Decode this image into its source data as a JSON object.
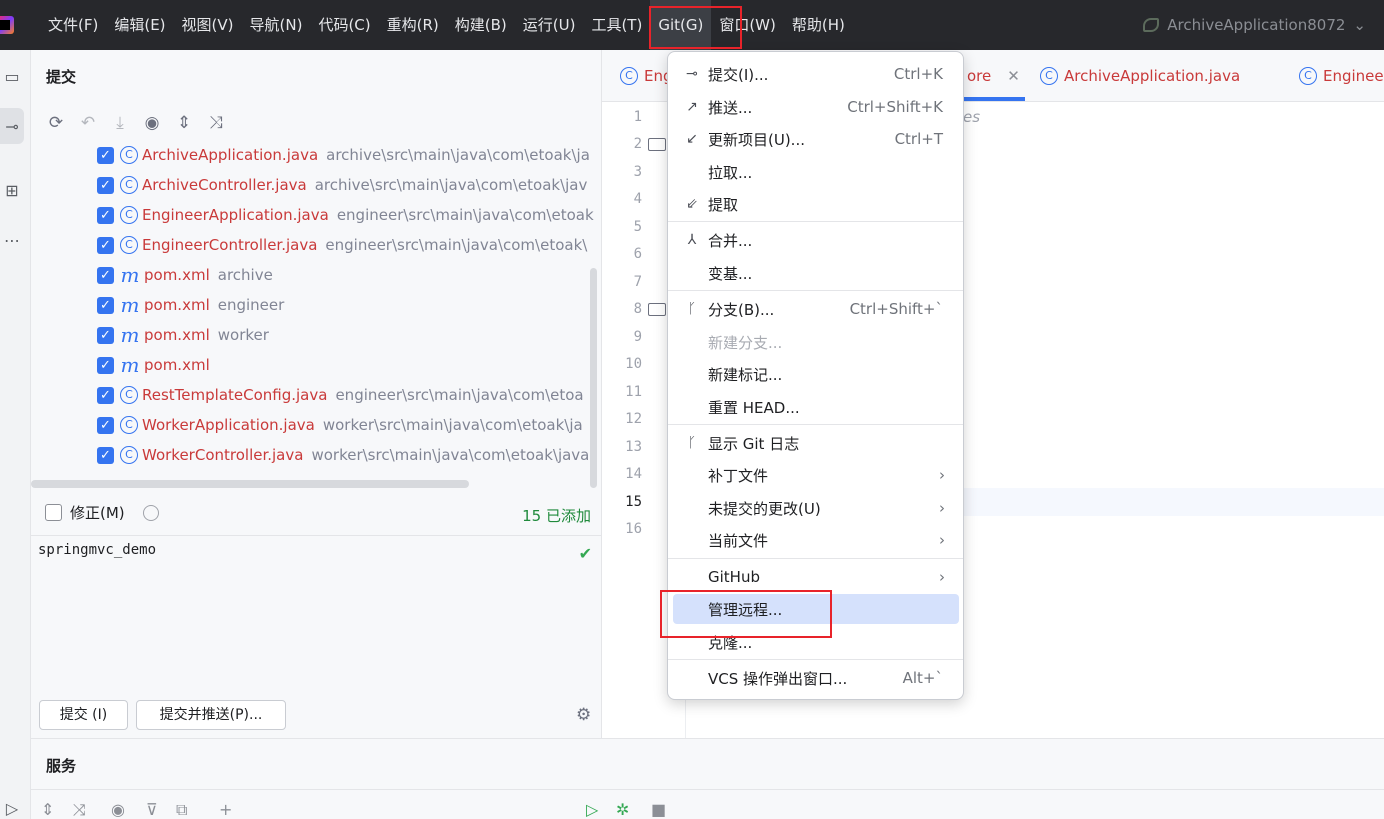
{
  "menubar": {
    "items": [
      "文件(F)",
      "编辑(E)",
      "视图(V)",
      "导航(N)",
      "代码(C)",
      "重构(R)",
      "构建(B)",
      "运行(U)",
      "工具(T)",
      "Git(G)",
      "窗口(W)",
      "帮助(H)"
    ],
    "run_config": "ArchiveApplication8072"
  },
  "commit_panel": {
    "title": "提交",
    "files": [
      {
        "name": "ArchiveApplication.java",
        "path": "archive\\src\\main\\java\\com\\etoak\\ja",
        "icon": "class-run-icon"
      },
      {
        "name": "ArchiveController.java",
        "path": "archive\\src\\main\\java\\com\\etoak\\jav",
        "icon": "class-icon"
      },
      {
        "name": "EngineerApplication.java",
        "path": "engineer\\src\\main\\java\\com\\etoak",
        "icon": "class-run-icon"
      },
      {
        "name": "EngineerController.java",
        "path": "engineer\\src\\main\\java\\com\\etoak\\",
        "icon": "class-icon"
      },
      {
        "name": "pom.xml",
        "path": "archive",
        "icon": "maven-icon"
      },
      {
        "name": "pom.xml",
        "path": "engineer",
        "icon": "maven-icon"
      },
      {
        "name": "pom.xml",
        "path": "worker",
        "icon": "maven-icon"
      },
      {
        "name": "pom.xml",
        "path": "",
        "icon": "maven-icon"
      },
      {
        "name": "RestTemplateConfig.java",
        "path": "engineer\\src\\main\\java\\com\\etoa",
        "icon": "class-icon"
      },
      {
        "name": "WorkerApplication.java",
        "path": "worker\\src\\main\\java\\com\\etoak\\ja",
        "icon": "class-run-icon"
      },
      {
        "name": "WorkerController.java",
        "path": "worker\\src\\main\\java\\com\\etoak\\java",
        "icon": "class-icon"
      }
    ],
    "amend_label": "修正(M)",
    "added_count": "15 已添加",
    "commit_message": "springmvc_demo",
    "commit_button": "提交 (I)",
    "commit_push_button": "提交并推送(P)..."
  },
  "editor": {
    "tabs": [
      {
        "label": "Eng"
      },
      {
        "label": "ore"
      },
      {
        "label": "ArchiveApplication.java"
      },
      {
        "label": "Enginee"
      }
    ],
    "line_numbers": [
      "1",
      "2",
      "3",
      "4",
      "5",
      "6",
      "7",
      "8",
      "9",
      "10",
      "11",
      "12",
      "13",
      "14",
      "15",
      "16"
    ],
    "current_line": "15",
    "code_fragment": "es"
  },
  "services": {
    "title": "服务"
  },
  "git_menu": {
    "items": [
      {
        "label": "提交(I)...",
        "shortcut": "Ctrl+K",
        "icon": "commit-icon"
      },
      {
        "label": "推送...",
        "shortcut": "Ctrl+Shift+K",
        "icon": "push-icon"
      },
      {
        "label": "更新项目(U)...",
        "shortcut": "Ctrl+T",
        "icon": "update-icon"
      },
      {
        "label": "拉取...",
        "shortcut": "",
        "icon": ""
      },
      {
        "label": "提取",
        "shortcut": "",
        "icon": "fetch-icon"
      },
      {
        "label": "合并...",
        "shortcut": "",
        "icon": "merge-icon"
      },
      {
        "label": "变基...",
        "shortcut": "",
        "icon": ""
      },
      {
        "label": "分支(B)...",
        "shortcut": "Ctrl+Shift+`",
        "icon": "branch-icon"
      },
      {
        "label": "新建分支...",
        "shortcut": "",
        "icon": ""
      },
      {
        "label": "新建标记...",
        "shortcut": "",
        "icon": ""
      },
      {
        "label": "重置 HEAD...",
        "shortcut": "",
        "icon": ""
      },
      {
        "label": "显示 Git 日志",
        "shortcut": "",
        "icon": "log-icon"
      },
      {
        "label": "补丁文件",
        "shortcut": "",
        "icon": ""
      },
      {
        "label": "未提交的更改(U)",
        "shortcut": "",
        "icon": ""
      },
      {
        "label": "当前文件",
        "shortcut": "",
        "icon": ""
      },
      {
        "label": "GitHub",
        "shortcut": "",
        "icon": ""
      },
      {
        "label": "管理远程...",
        "shortcut": "",
        "icon": ""
      },
      {
        "label": "克隆...",
        "shortcut": "",
        "icon": ""
      },
      {
        "label": "VCS 操作弹出窗口...",
        "shortcut": "Alt+`",
        "icon": ""
      }
    ],
    "hovered": "管理远程..."
  },
  "colors": {
    "accent": "#3574f0",
    "highlight_box": "#e8232a",
    "modified_file": "#c93a3a",
    "added_text": "#208a3c"
  }
}
